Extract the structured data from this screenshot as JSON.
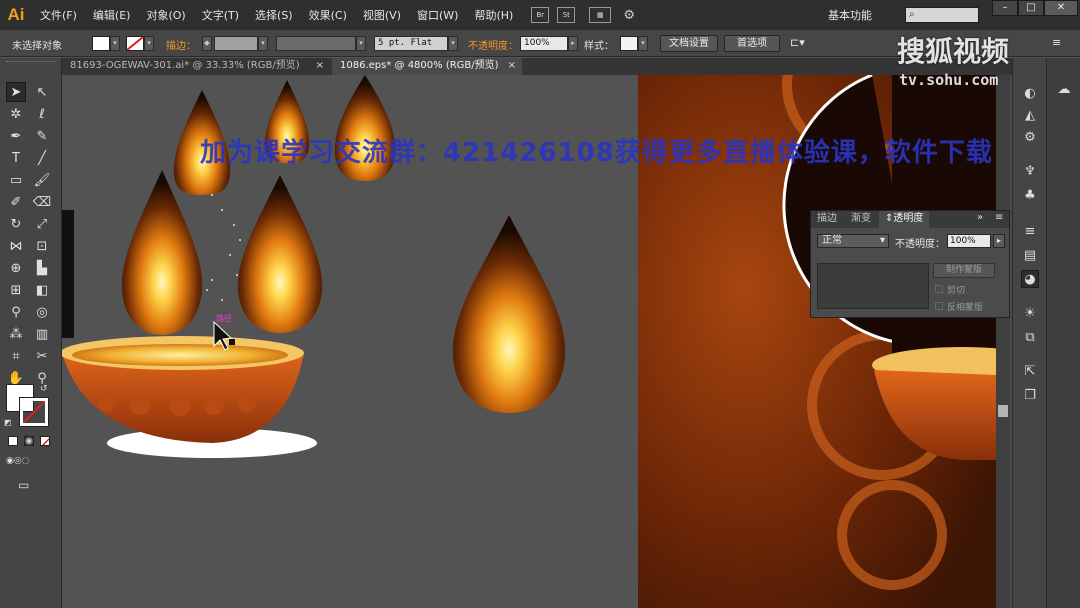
{
  "app": {
    "logo": "Ai"
  },
  "menu": [
    "文件(F)",
    "编辑(E)",
    "对象(O)",
    "文字(T)",
    "选择(S)",
    "效果(C)",
    "视图(V)",
    "窗口(W)",
    "帮助(H)"
  ],
  "menubar_icons": {
    "bridge": "Br",
    "stock": "St"
  },
  "workspace": "基本功能",
  "search": {
    "placeholder": ""
  },
  "control_bar": {
    "selection": "未选择对象",
    "stroke_label": "描边：",
    "stroke_profile": "5 pt. Flat",
    "opacity_label": "不透明度：",
    "opacity_value": "100%",
    "style_label": "样式：",
    "doc_settings": "文档设置",
    "preferences": "首选项"
  },
  "tabs": [
    {
      "label": "81693-OGEWAV-301.ai* @ 33.33% (RGB/预览)",
      "close": "×"
    },
    {
      "label": "1086.eps* @ 4800% (RGB/预览)",
      "close": "×"
    }
  ],
  "transparency_panel": {
    "tabs": [
      "描边",
      "渐变",
      "透明度"
    ],
    "blend_mode": "正常",
    "opacity_label": "不透明度：",
    "opacity_value": "100%",
    "make_mask": "制作蒙版",
    "clip": "剪切",
    "invert_mask": "反相蒙版"
  },
  "cursor_label": "路径",
  "watermark": "加为课学习交流群：421426108获得更多直播体验课，软件下载",
  "brand": {
    "name": "搜狐视频",
    "url": "tv.sohu.com"
  },
  "colors": {
    "accent_orange": "#f39b2a",
    "menubar": "#2f2f2f",
    "panel": "#454545",
    "canvas": "#535353",
    "watermark": "#2a35c0"
  }
}
